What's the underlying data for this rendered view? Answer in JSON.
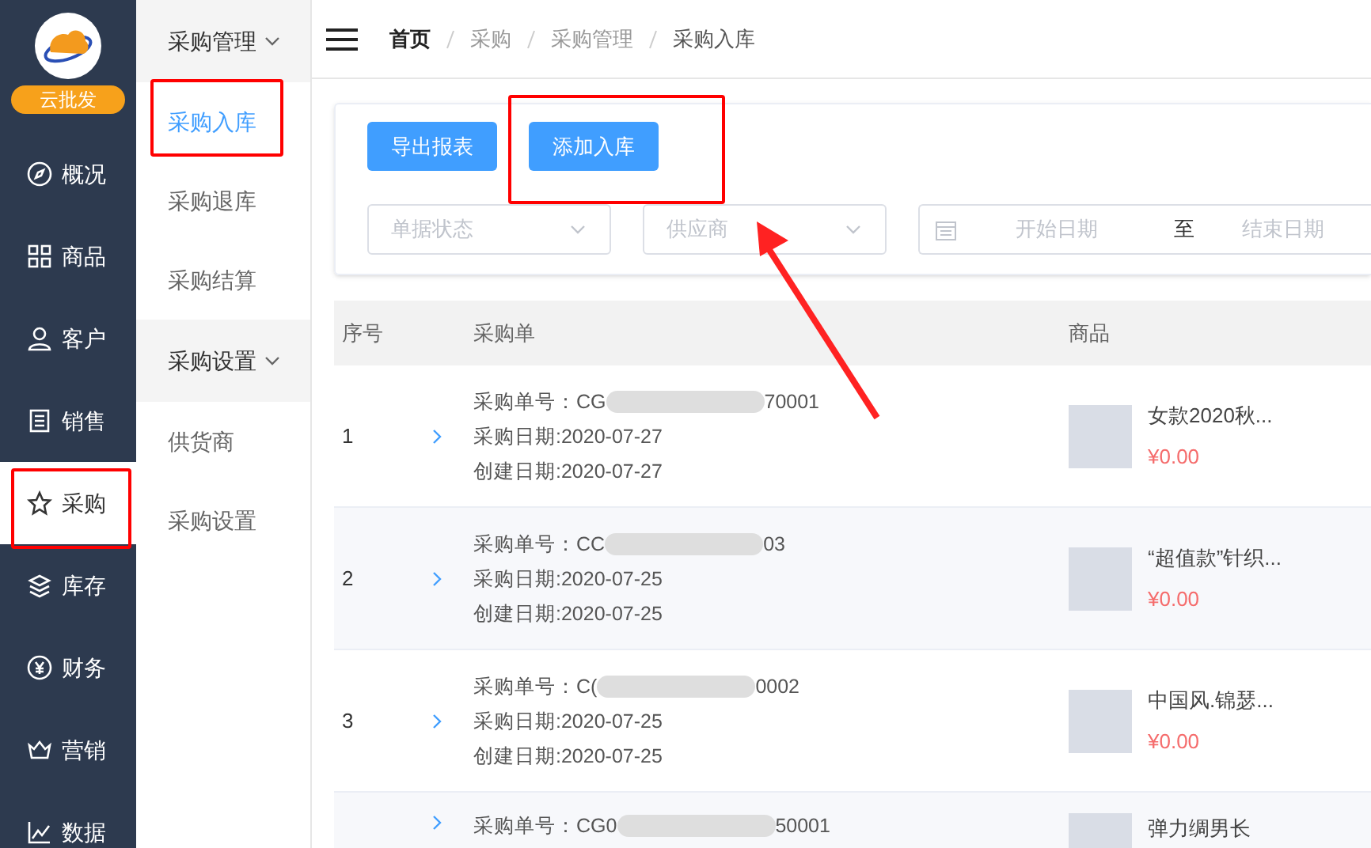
{
  "brand": {
    "badge": "云批发"
  },
  "nav": [
    {
      "label": "概况",
      "selected": false
    },
    {
      "label": "商品",
      "selected": false
    },
    {
      "label": "客户",
      "selected": false
    },
    {
      "label": "销售",
      "selected": false
    },
    {
      "label": "采购",
      "selected": true
    },
    {
      "label": "库存",
      "selected": false
    },
    {
      "label": "财务",
      "selected": false
    },
    {
      "label": "营销",
      "selected": false
    },
    {
      "label": "数据",
      "selected": false
    }
  ],
  "submenu": [
    {
      "title": "采购管理",
      "expanded": true,
      "items": [
        {
          "label": "采购入库",
          "selected": true
        },
        {
          "label": "采购退库",
          "selected": false
        },
        {
          "label": "采购结算",
          "selected": false
        }
      ]
    },
    {
      "title": "采购设置",
      "expanded": true,
      "items": [
        {
          "label": "供货商",
          "selected": false
        },
        {
          "label": "采购设置",
          "selected": false
        }
      ]
    }
  ],
  "breadcrumb": [
    "首页",
    "采购",
    "采购管理",
    "采购入库"
  ],
  "buttons": [
    "导出报表",
    "添加入库"
  ],
  "filters": {
    "status": {
      "placeholder": "单据状态"
    },
    "supplier": {
      "placeholder": "供应商"
    },
    "date_start": {
      "placeholder": "开始日期"
    },
    "date_sep": "至",
    "date_end": {
      "placeholder": "结束日期"
    }
  },
  "table": {
    "columns": [
      "序号",
      "采购单",
      "商品"
    ],
    "rows": [
      {
        "index": "1",
        "order_prefix": "采购单号：CG",
        "order_suffix": "70001",
        "purchase_date": "采购日期:2020-07-27",
        "created_date": "创建日期:2020-07-27",
        "product": "女款2020秋...",
        "price": "¥0.00"
      },
      {
        "index": "2",
        "order_prefix": "采购单号：CC",
        "order_suffix": "03",
        "purchase_date": "采购日期:2020-07-25",
        "created_date": "创建日期:2020-07-25",
        "product": "“超值款”针织...",
        "price": "¥0.00"
      },
      {
        "index": "3",
        "order_prefix": "采购单号：C(",
        "order_suffix": "0002",
        "purchase_date": "采购日期:2020-07-25",
        "created_date": "创建日期:2020-07-25",
        "product": "中国风.锦瑟...",
        "price": "¥0.00"
      },
      {
        "index": "",
        "order_prefix": "采购单号：CG0",
        "order_suffix": "50001",
        "product": "弹力绸男长"
      }
    ]
  }
}
